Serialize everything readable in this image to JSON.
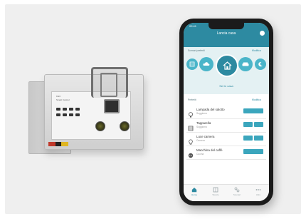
{
  "colors": {
    "app_accent": "#2d8aa1",
    "control_teal": "#3ba6bd",
    "scene_light": "#4ab5c9",
    "background": "#efefef"
  },
  "phone": {
    "status_time": "09:41",
    "app_title": "Lancia casa",
    "scenes_label": "Scenari preferiti",
    "scenes_edit": "Modifica",
    "active_scene": "Sei in casa",
    "scene_icons": [
      "blind-icon",
      "cloud-icon",
      "home-icon",
      "sofa-icon",
      "moon-icon"
    ],
    "list_label": "Preferiti",
    "list_edit": "Modifica",
    "rows": [
      {
        "title": "Lampada del salotto",
        "subtitle": "Soggiorno",
        "icon": "lamp-icon",
        "control": "toggle"
      },
      {
        "title": "Tapparella",
        "subtitle": "Soggiorno",
        "icon": "blind-icon",
        "control": "split"
      },
      {
        "title": "Luce camera",
        "subtitle": "Camera",
        "icon": "bulb-icon",
        "control": "split"
      },
      {
        "title": "Macchina del caffè",
        "subtitle": "Cucina",
        "icon": "plug-icon",
        "control": "toggle"
      }
    ],
    "tabs": [
      {
        "label": "Home",
        "icon": "home-tab-icon",
        "active": true
      },
      {
        "label": "Stanze",
        "icon": "rooms-tab-icon",
        "active": false
      },
      {
        "label": "Scenari",
        "icon": "scenes-tab-icon",
        "active": false
      },
      {
        "label": "Altro",
        "icon": "more-tab-icon",
        "active": false
      }
    ]
  },
  "device": {
    "printed_text": [
      "KNX",
      "Smart Control"
    ]
  }
}
